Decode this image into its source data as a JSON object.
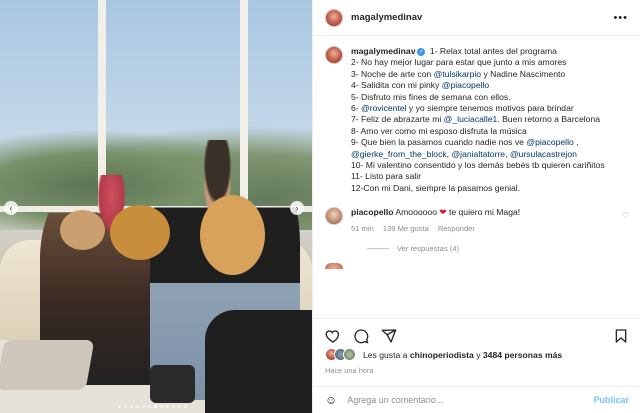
{
  "post": {
    "username": "magalymedinav",
    "caption_lines": [
      "1- Relax total antes del programa",
      "2- No hay mejor lugar para estar que junto a mis amores",
      "3- Noche de arte con ",
      "Nadine Nascimento",
      "4- Salidita con mi pinky ",
      "5- Disfruto mis fines de semana con ellos.",
      "6- ",
      " y yo siempre tenemos motivos para brindar",
      "7- Feliz de abrazarte mi ",
      ". Buen retorno a Barcelona",
      "8- Amo ver como mi esposo disfruta la música",
      "9- Que bien la pasamos cuando nadie nos ve ",
      "10- Mi valentino consentido y los demás bebés tb quieren cariñitos",
      "11- Listo para salir",
      "12-Con mi Dani, siempre la pasamos genial."
    ],
    "mentions": {
      "tulsikarpio": "@tulsikarpio",
      "piacopello": "@piacopello",
      "rovicentel": "@rovicentel",
      "luciacalle1": "@_luciacalle1",
      "gierke": "@gierke_from_the_block",
      "janialtatorre": "@janialtatorre",
      "ursulacastrejon": "@ursulacastrejon"
    },
    "comma": ",",
    "and_word": " y "
  },
  "comment": {
    "username": "piacopello",
    "text": " Amoooooo",
    "text_after": " te quiero mi Maga!",
    "time": "51 min",
    "likes": "139 Me gusta",
    "reply": "Responder"
  },
  "replies_label": "Ver respuestas (4)",
  "likes_line": {
    "prefix": "Les gusta a ",
    "user": "chinoperiodista",
    "middle": " y ",
    "count": "3484 personas más"
  },
  "time_ago": "Hace una hora",
  "add_comment": {
    "placeholder": "Agrega un comentario...",
    "publish": "Publicar"
  },
  "icons": {
    "nav_prev": "chevron-left-icon",
    "nav_next": "chevron-right-icon",
    "more": "more-options-icon",
    "like": "heart-icon",
    "comment": "comment-icon",
    "share": "share-icon",
    "save": "bookmark-icon",
    "emoji": "emoji-icon",
    "verified": "verified-badge-icon"
  },
  "colors": {
    "link": "#00376b",
    "verified": "#3897f0",
    "publish": "#0095f6",
    "heart": "#e0172c"
  }
}
